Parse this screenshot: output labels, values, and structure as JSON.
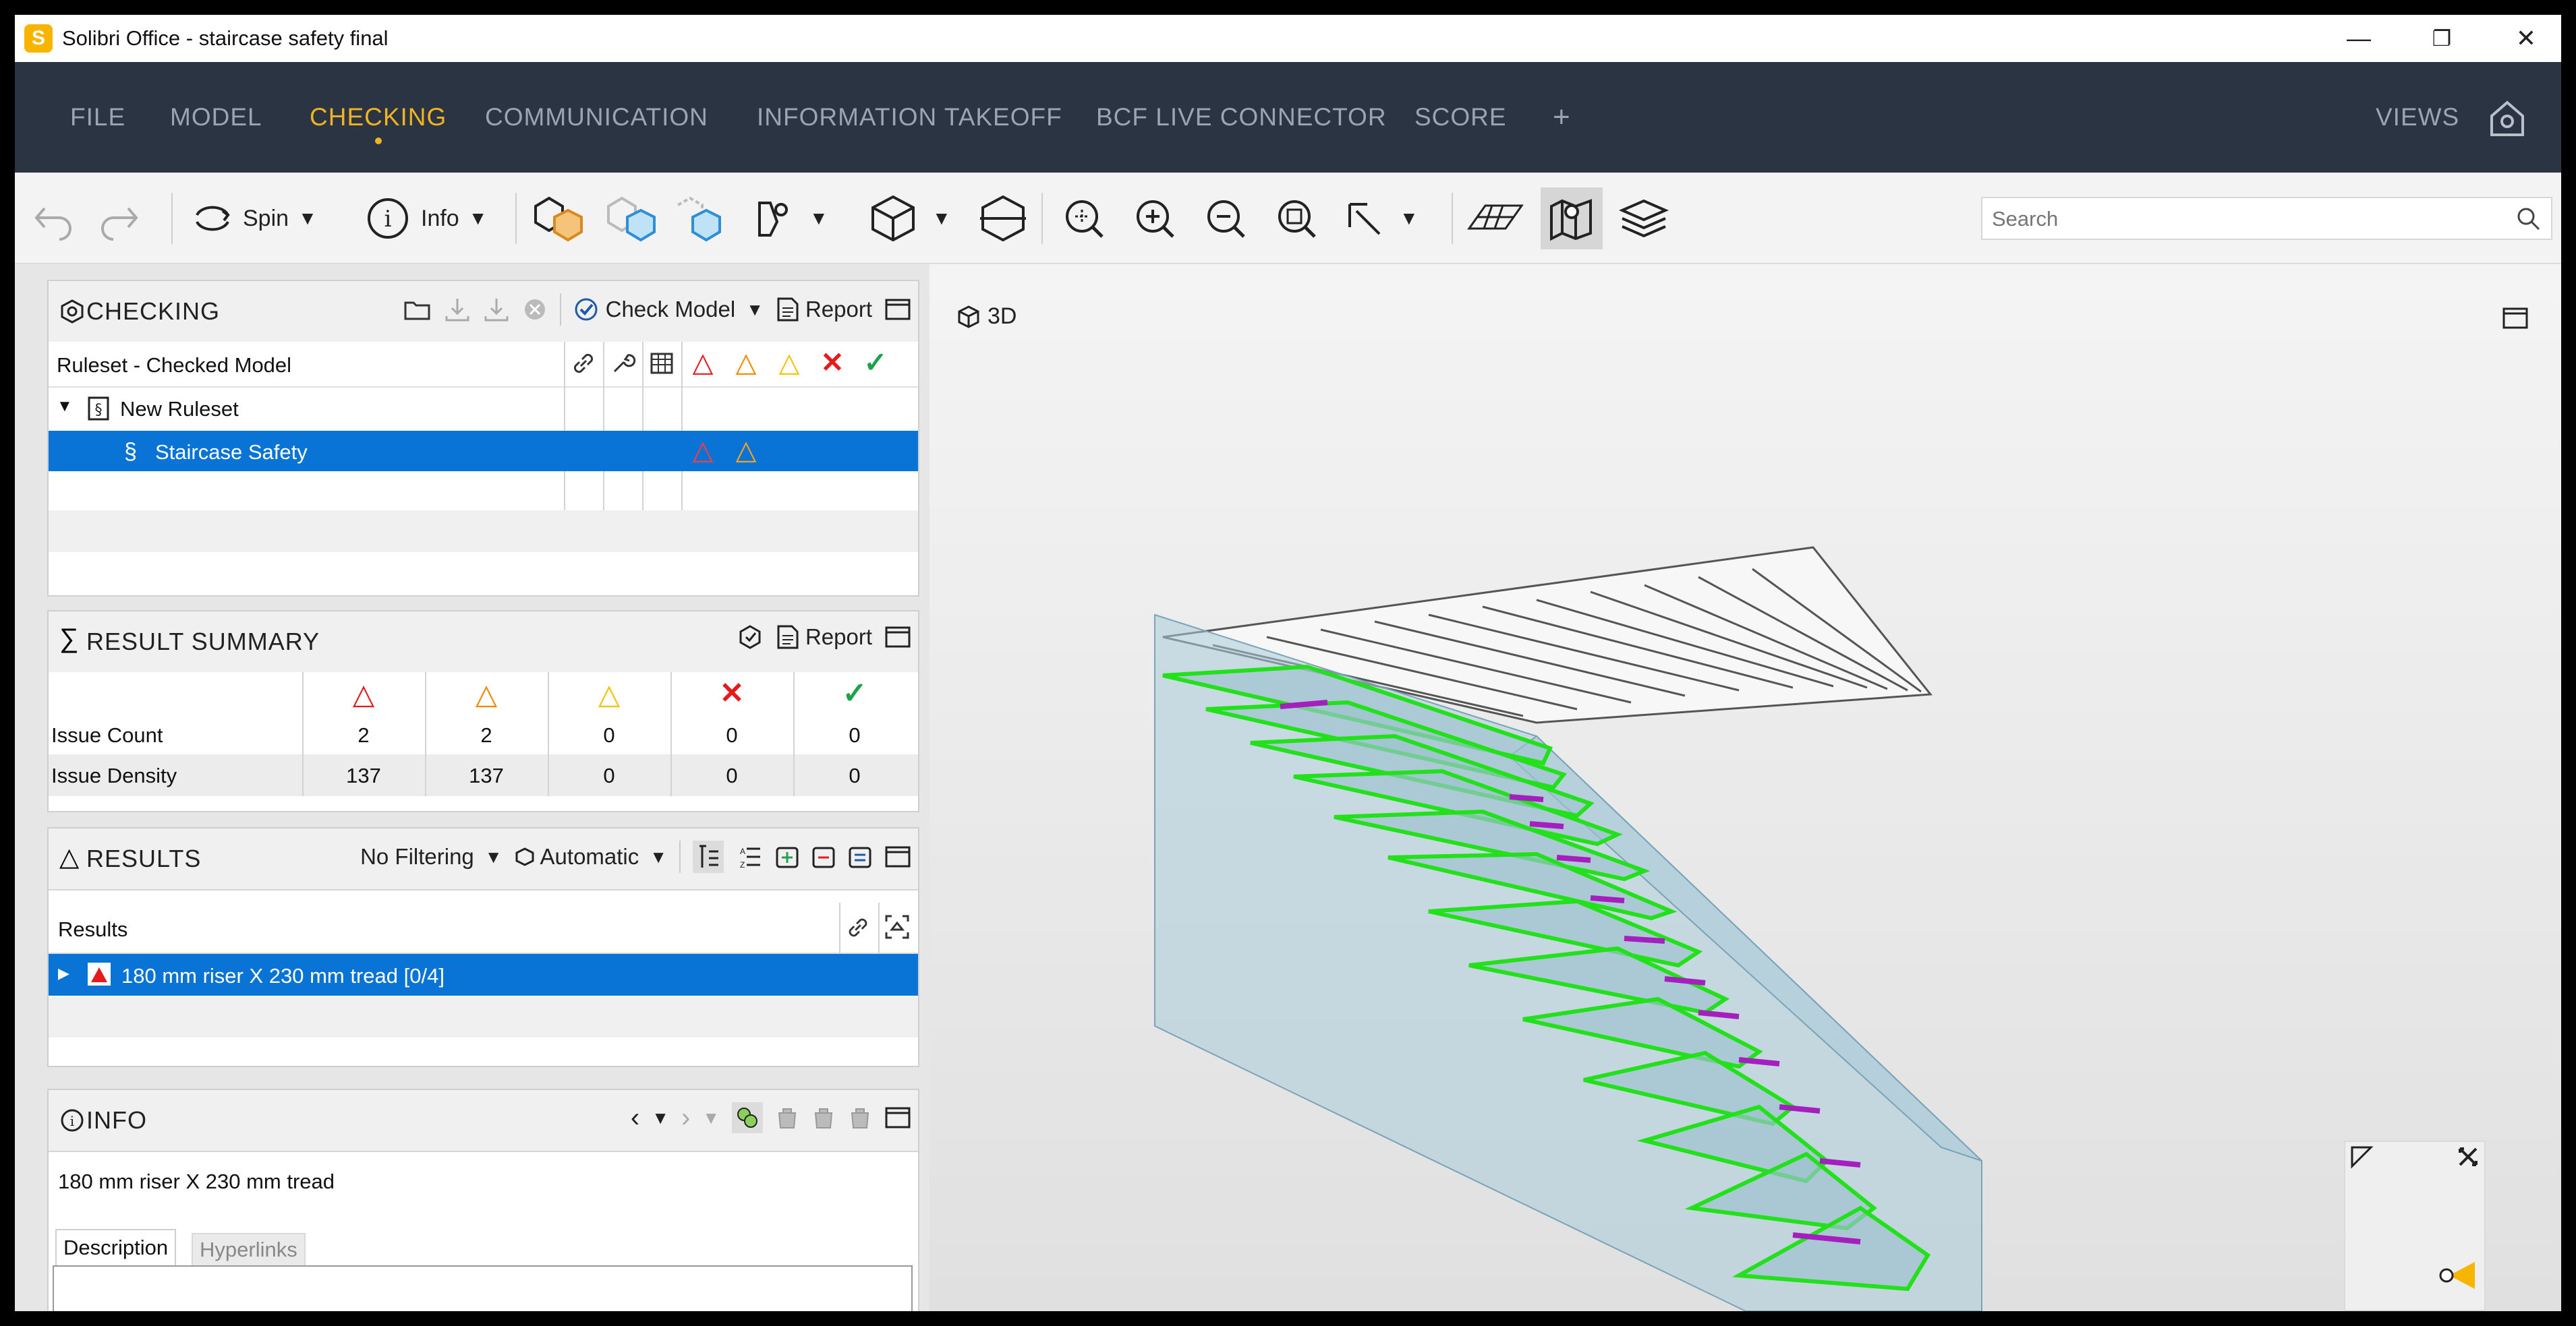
{
  "window": {
    "title": "Solibri Office - staircase safety final",
    "logo_letter": "S",
    "minimize": "—",
    "restore": "❐",
    "close": "✕"
  },
  "menu": {
    "items": [
      "FILE",
      "MODEL",
      "CHECKING",
      "COMMUNICATION",
      "INFORMATION TAKEOFF",
      "BCF LIVE CONNECTOR",
      "SCORE",
      "+"
    ],
    "active": "CHECKING",
    "views_label": "VIEWS"
  },
  "toolbar": {
    "spin_label": "Spin",
    "info_label": "Info",
    "search_placeholder": "Search"
  },
  "checking": {
    "title": "CHECKING",
    "check_model_label": "Check Model",
    "report_label": "Report",
    "column_title": "Ruleset - Checked Model",
    "ruleset_name": "New Ruleset",
    "rule_name": "Staircase Safety"
  },
  "summary": {
    "title": "RESULT SUMMARY",
    "report_label": "Report",
    "rows": [
      {
        "label": "Issue Count",
        "values": [
          "2",
          "2",
          "0",
          "0",
          "0"
        ]
      },
      {
        "label": "Issue Density",
        "values": [
          "137",
          "137",
          "0",
          "0",
          "0"
        ]
      }
    ]
  },
  "results": {
    "title": "RESULTS",
    "filter_label": "No Filtering",
    "mode_label": "Automatic",
    "column_title": "Results",
    "item_label": "180 mm riser X 230 mm tread [0/4]"
  },
  "info": {
    "title": "INFO",
    "selected_name": "180 mm riser X 230 mm tread",
    "tabs": [
      "Description",
      "Hyperlinks"
    ],
    "active_tab": "Description"
  },
  "view3d": {
    "label": "3D"
  },
  "colors": {
    "menubar": "#2b3442",
    "accent": "#f0b322",
    "selection": "#0a74d6",
    "critical": "#e51b1b",
    "moderate": "#f08a00",
    "low": "#f4c300",
    "rejected": "#e51b1b",
    "passed": "#1ea34a"
  }
}
